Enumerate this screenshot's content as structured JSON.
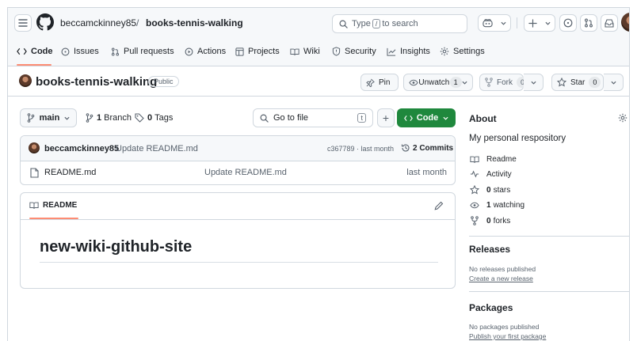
{
  "header": {
    "owner": "beccamckinney85",
    "separator": "/",
    "repo": "books-tennis-walking",
    "search_prefix": "Type",
    "search_key": "/",
    "search_suffix": "to search"
  },
  "tabs": [
    {
      "label": "Code",
      "icon": "code-icon"
    },
    {
      "label": "Issues",
      "icon": "issue-icon"
    },
    {
      "label": "Pull requests",
      "icon": "pull-request-icon"
    },
    {
      "label": "Actions",
      "icon": "play-icon"
    },
    {
      "label": "Projects",
      "icon": "table-icon"
    },
    {
      "label": "Wiki",
      "icon": "book-icon"
    },
    {
      "label": "Security",
      "icon": "shield-icon"
    },
    {
      "label": "Insights",
      "icon": "graph-icon"
    },
    {
      "label": "Settings",
      "icon": "gear-icon"
    }
  ],
  "repo_bar": {
    "name": "books-tennis-walking",
    "visibility": "Public",
    "pin": "Pin",
    "unwatch": "Unwatch",
    "watch_count": "1",
    "fork": "Fork",
    "fork_count": "0",
    "star": "Star",
    "star_count": "0"
  },
  "file_nav": {
    "branch": "main",
    "branches_count": "1",
    "branches_label": "Branch",
    "tags_count": "0",
    "tags_label": "Tags",
    "go_to_file": "Go to file",
    "go_to_file_key": "t",
    "add": "+",
    "code": "Code"
  },
  "commit": {
    "author": "beccamckinney85",
    "message": "Update README.md",
    "hash_time": "c367789 · last month",
    "commits": "2 Commits"
  },
  "files": [
    {
      "name": "README.md",
      "message": "Update README.md",
      "time": "last month"
    }
  ],
  "readme": {
    "tab_label": "README",
    "heading": "new-wiki-github-site"
  },
  "about": {
    "title": "About",
    "description": "My personal respository",
    "readme": "Readme",
    "activity": "Activity",
    "stars_count": "0",
    "stars_label": "stars",
    "watching_count": "1",
    "watching_label": "watching",
    "forks_count": "0",
    "forks_label": "forks"
  },
  "releases": {
    "title": "Releases",
    "empty": "No releases published",
    "create": "Create a new release"
  },
  "packages": {
    "title": "Packages",
    "empty": "No packages published",
    "publish": "Publish your first package"
  },
  "colors": {
    "accent_green": "#1f883d",
    "link_blue": "#0969da",
    "tab_underline": "#fd8c73",
    "border": "#d0d7de"
  }
}
